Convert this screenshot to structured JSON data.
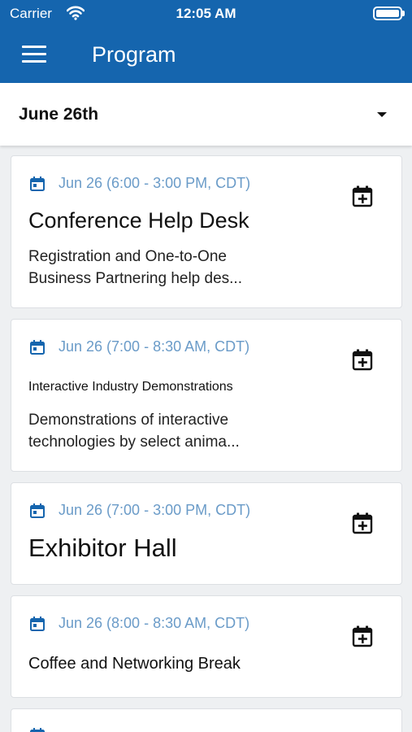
{
  "status_bar": {
    "carrier": "Carrier",
    "time": "12:05 AM"
  },
  "app_bar": {
    "title": "Program"
  },
  "date_selector": {
    "selected": "June 26th"
  },
  "sessions": [
    {
      "time": "Jun 26 (6:00 - 3:00 PM, CDT)",
      "title": "Conference Help Desk",
      "description_line1": "Registration and One-to-One",
      "description_line2": "Business Partnering help des..."
    },
    {
      "time": "Jun 26 (7:00 - 8:30 AM, CDT)",
      "title": "Interactive Industry Demonstrations",
      "description_line1": "Demonstrations of interactive",
      "description_line2": "technologies by select anima..."
    },
    {
      "time": "Jun 26 (7:00 - 3:00 PM, CDT)",
      "title": "Exhibitor Hall"
    },
    {
      "time": "Jun 26 (8:00 - 8:30 AM, CDT)",
      "title": "Coffee and Networking Break"
    }
  ],
  "colors": {
    "primary": "#1565ae",
    "time_text": "#6a9bc8",
    "background": "#eef0f2"
  }
}
